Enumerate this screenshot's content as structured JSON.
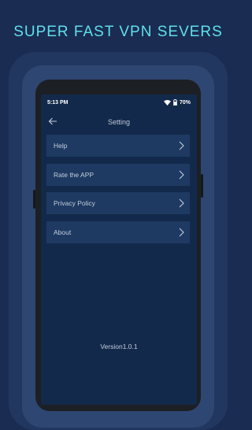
{
  "headline": "SUPER FAST VPN SEVERS",
  "status_bar": {
    "time": "5:13 PM",
    "battery": "70%"
  },
  "app_bar": {
    "title": "Setting"
  },
  "menu": [
    {
      "label": "Help"
    },
    {
      "label": "Rate the APP"
    },
    {
      "label": "Privacy Policy"
    },
    {
      "label": "About"
    }
  ],
  "version": "Version1.0.1",
  "icons": {
    "back": "back-arrow-icon",
    "chevron": "chevron-right-icon",
    "wifi": "wifi-icon",
    "battery": "battery-icon"
  },
  "colors": {
    "background": "#1a2c52",
    "headline": "#5fe0ea",
    "screen": "#13294b",
    "item": "#1e3a62"
  }
}
